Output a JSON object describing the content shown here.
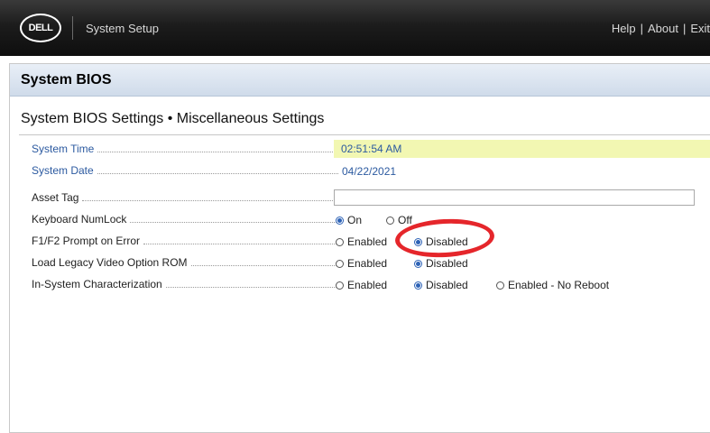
{
  "header": {
    "logo_text": "DELL",
    "app_title": "System Setup",
    "links": [
      "Help",
      "About",
      "Exit"
    ]
  },
  "panel": {
    "title": "System BIOS",
    "section_title": "System BIOS Settings • Miscellaneous Settings"
  },
  "settings": {
    "system_time": {
      "label": "System Time",
      "value": "02:51:54 AM"
    },
    "system_date": {
      "label": "System Date",
      "value": "04/22/2021"
    },
    "asset_tag": {
      "label": "Asset Tag",
      "value": ""
    },
    "keyboard_numlock": {
      "label": "Keyboard NumLock",
      "options": [
        "On",
        "Off"
      ],
      "selected": "On"
    },
    "f1f2_prompt": {
      "label": "F1/F2 Prompt on Error",
      "options": [
        "Enabled",
        "Disabled"
      ],
      "selected": "Disabled"
    },
    "legacy_video": {
      "label": "Load Legacy Video Option ROM",
      "options": [
        "Enabled",
        "Disabled"
      ],
      "selected": "Disabled"
    },
    "in_system_char": {
      "label": "In-System Characterization",
      "options": [
        "Enabled",
        "Disabled",
        "Enabled - No Reboot"
      ],
      "selected": "Disabled"
    }
  },
  "colors": {
    "highlight_field": "#f2f7b2",
    "accent_blue": "#2c5aa0",
    "annotation_red": "#e5262b"
  }
}
